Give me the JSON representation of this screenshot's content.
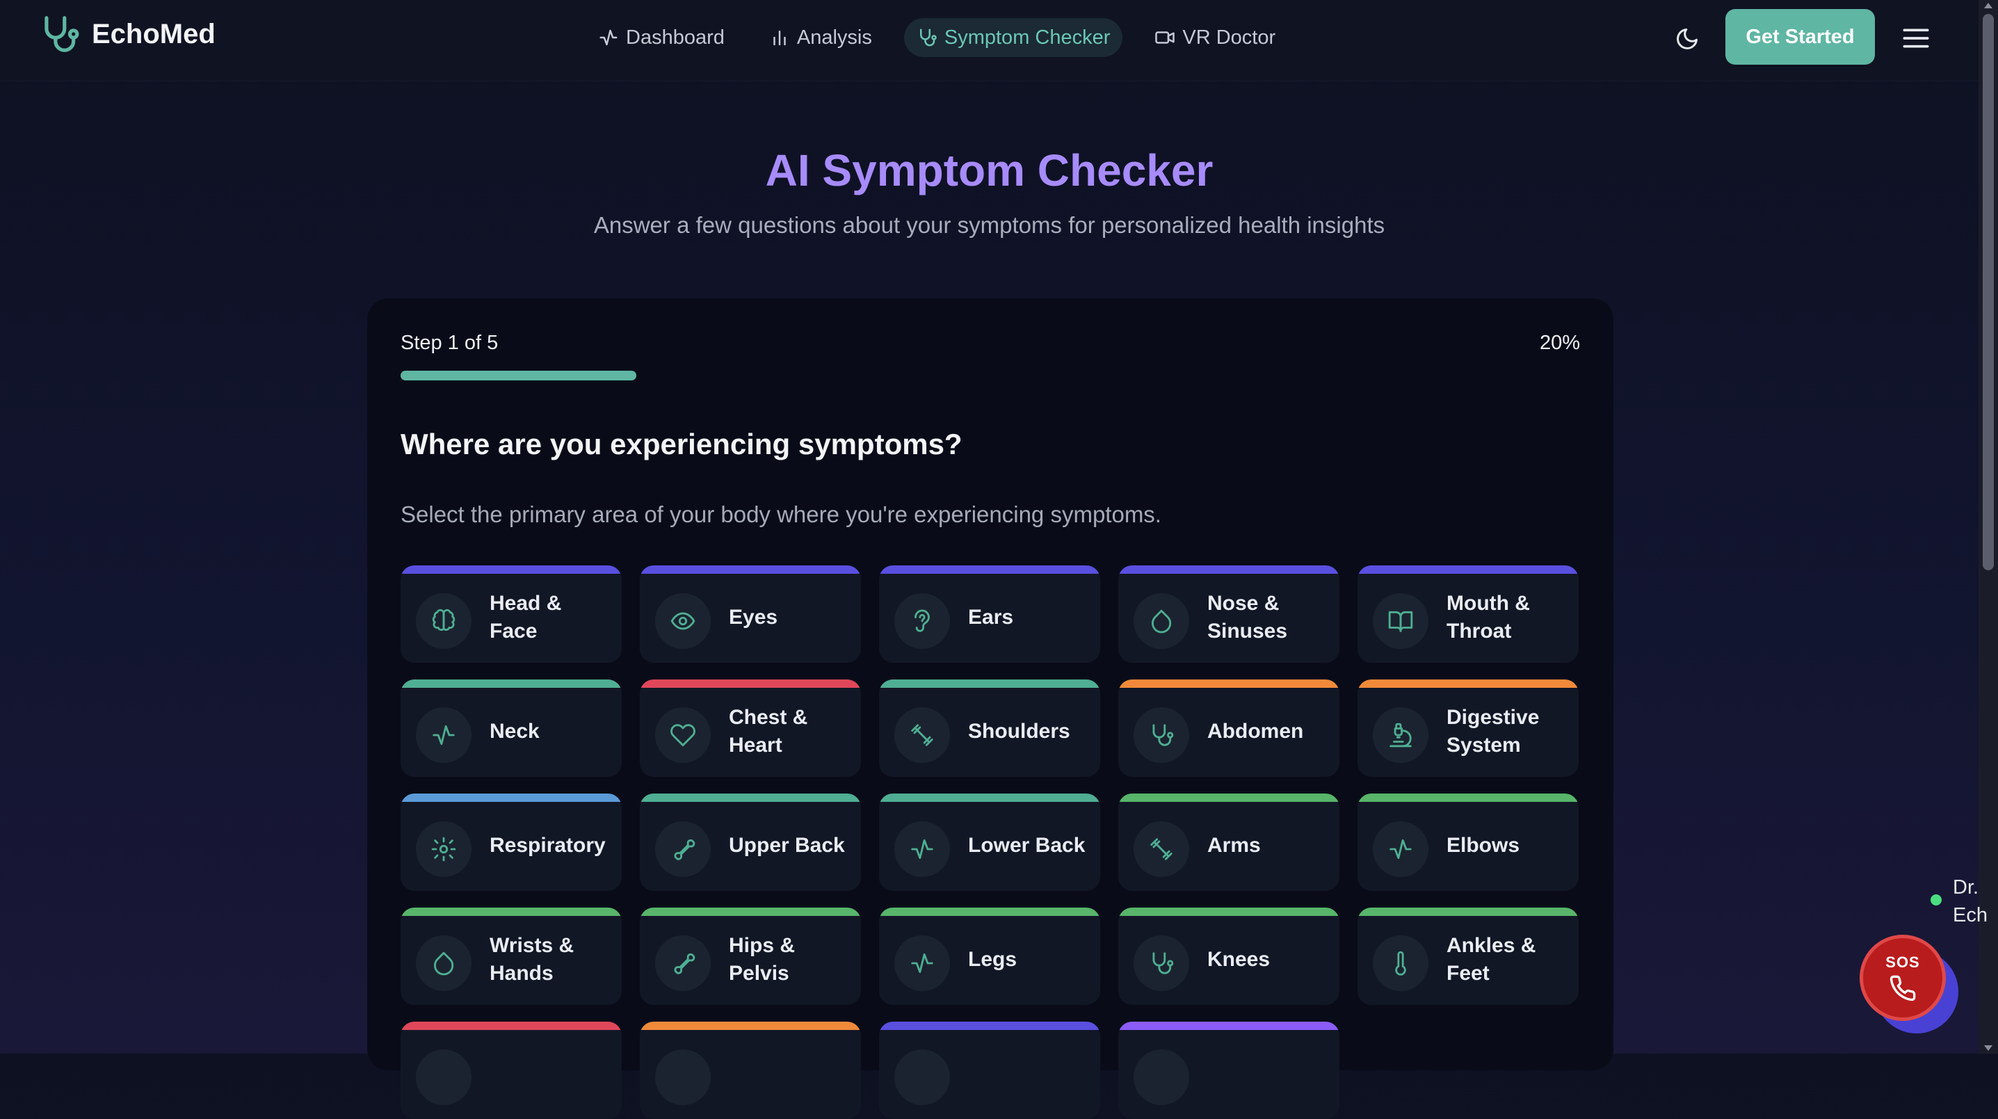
{
  "brand": {
    "name": "EchoMed"
  },
  "nav": [
    {
      "label": "Dashboard",
      "icon": "activity-icon",
      "active": false
    },
    {
      "label": "Analysis",
      "icon": "bar-chart-icon",
      "active": false
    },
    {
      "label": "Symptom Checker",
      "icon": "stethoscope-icon",
      "active": true
    },
    {
      "label": "VR Doctor",
      "icon": "video-icon",
      "active": false
    }
  ],
  "header": {
    "cta": "Get Started"
  },
  "hero": {
    "title": "AI Symptom Checker",
    "subtitle": "Answer a few questions about your symptoms for personalized health insights"
  },
  "step": {
    "label": "Step 1 of 5",
    "percent_label": "20%",
    "progress": 0.2,
    "question": "Where are you experiencing symptoms?",
    "instruction": "Select the primary area of your body where you're experiencing symptoms."
  },
  "colors": {
    "accent": "#5fb6a3",
    "title": "#a78bfa",
    "indigo": "#5b4fe0",
    "red": "#e0475a",
    "teal": "#4fae93",
    "orange": "#f08a3a",
    "blue": "#5b9bd8",
    "green": "#58b56a",
    "purple": "#8b5cf6"
  },
  "body_areas": [
    {
      "label": "Head & Face",
      "icon": "brain-icon",
      "color": "indigo"
    },
    {
      "label": "Eyes",
      "icon": "eye-icon",
      "color": "indigo"
    },
    {
      "label": "Ears",
      "icon": "ear-icon",
      "color": "indigo"
    },
    {
      "label": "Nose & Sinuses",
      "icon": "droplet-icon",
      "color": "indigo"
    },
    {
      "label": "Mouth & Throat",
      "icon": "book-open-icon",
      "color": "indigo"
    },
    {
      "label": "Neck",
      "icon": "activity-icon",
      "color": "teal"
    },
    {
      "label": "Chest & Heart",
      "icon": "heart-icon",
      "color": "red"
    },
    {
      "label": "Shoulders",
      "icon": "dumbbell-icon",
      "color": "teal"
    },
    {
      "label": "Abdomen",
      "icon": "stethoscope-icon",
      "color": "orange"
    },
    {
      "label": "Digestive System",
      "icon": "microscope-icon",
      "color": "orange"
    },
    {
      "label": "Respiratory",
      "icon": "gear-icon",
      "color": "blue"
    },
    {
      "label": "Upper Back",
      "icon": "bone-icon",
      "color": "teal"
    },
    {
      "label": "Lower Back",
      "icon": "activity-icon",
      "color": "teal"
    },
    {
      "label": "Arms",
      "icon": "dumbbell-icon",
      "color": "green"
    },
    {
      "label": "Elbows",
      "icon": "activity-icon",
      "color": "green"
    },
    {
      "label": "Wrists & Hands",
      "icon": "droplet-icon",
      "color": "green"
    },
    {
      "label": "Hips & Pelvis",
      "icon": "bone-icon",
      "color": "green"
    },
    {
      "label": "Legs",
      "icon": "activity-icon",
      "color": "green"
    },
    {
      "label": "Knees",
      "icon": "stethoscope-icon",
      "color": "green"
    },
    {
      "label": "Ankles & Feet",
      "icon": "thermometer-icon",
      "color": "green"
    },
    {
      "label": "",
      "icon": "",
      "color": "red"
    },
    {
      "label": "",
      "icon": "",
      "color": "orange"
    },
    {
      "label": "",
      "icon": "",
      "color": "indigo"
    },
    {
      "label": "",
      "icon": "",
      "color": "purple"
    }
  ],
  "assistant": {
    "line1": "Dr.",
    "line2": "Ech"
  },
  "sos": {
    "label": "SOS"
  }
}
